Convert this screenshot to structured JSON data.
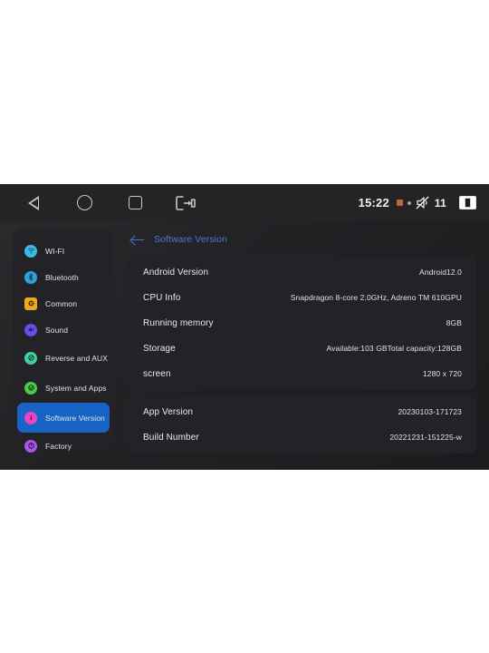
{
  "statusbar": {
    "nav": [
      {
        "name": "back-icon",
        "label": "Back"
      },
      {
        "name": "home-icon",
        "label": "Home"
      },
      {
        "name": "recents-icon",
        "label": "Recents"
      },
      {
        "name": "exit-app-icon",
        "label": "Exit"
      }
    ],
    "clock": "15:22",
    "volume_level": "11",
    "icons": {
      "recording_indicator": "record-square-icon",
      "location_dot": "location-dot-icon",
      "mute": "speaker-muted-icon",
      "battery": "battery-icon"
    }
  },
  "sidebar": {
    "items": [
      {
        "label": "WI-FI",
        "icon": "wifi-icon",
        "color": "#39b9e8",
        "active": false
      },
      {
        "label": "Bluetooth",
        "icon": "bluetooth-icon",
        "color": "#2f9fe0",
        "active": false
      },
      {
        "label": "Common",
        "icon": "gear-icon",
        "color": "#f0a71d",
        "active": false
      },
      {
        "label": "Sound",
        "icon": "speaker-icon",
        "color": "#6a4ce8",
        "active": false
      },
      {
        "label": "Reverse and AUX",
        "icon": "reverse-camera-icon",
        "color": "#3fd2a0",
        "active": false
      },
      {
        "label": "System and Apps",
        "icon": "apps-icon",
        "color": "#4cc94c",
        "active": false
      },
      {
        "label": "Software Version",
        "icon": "info-icon",
        "color": "#ec44c4",
        "active": true
      },
      {
        "label": "Factory",
        "icon": "factory-icon",
        "color": "#a855e8",
        "active": false
      }
    ]
  },
  "content": {
    "title": "Software Version",
    "back_icon": "back-arrow-icon",
    "cards": [
      {
        "rows": [
          {
            "key": "Android Version",
            "value": "Android12.0"
          },
          {
            "key": "CPU Info",
            "value": "Snapdragon 8-core 2.0GHz, Adreno TM 610GPU"
          },
          {
            "key": "Running memory",
            "value": "8GB"
          },
          {
            "key": "Storage",
            "value": "Available:103 GBTotal capacity:128GB"
          },
          {
            "key": "screen",
            "value": "1280 x 720"
          }
        ]
      },
      {
        "rows": [
          {
            "key": "App Version",
            "value": "20230103-171723"
          },
          {
            "key": "Build Number",
            "value": "20221231-151225-w"
          }
        ]
      }
    ]
  },
  "colors": {
    "accent_blue": "#1763c6",
    "title_blue": "#5274d8",
    "card_bg": "#232327",
    "page_bg": "#212124",
    "statusbar_bg": "#242427"
  }
}
